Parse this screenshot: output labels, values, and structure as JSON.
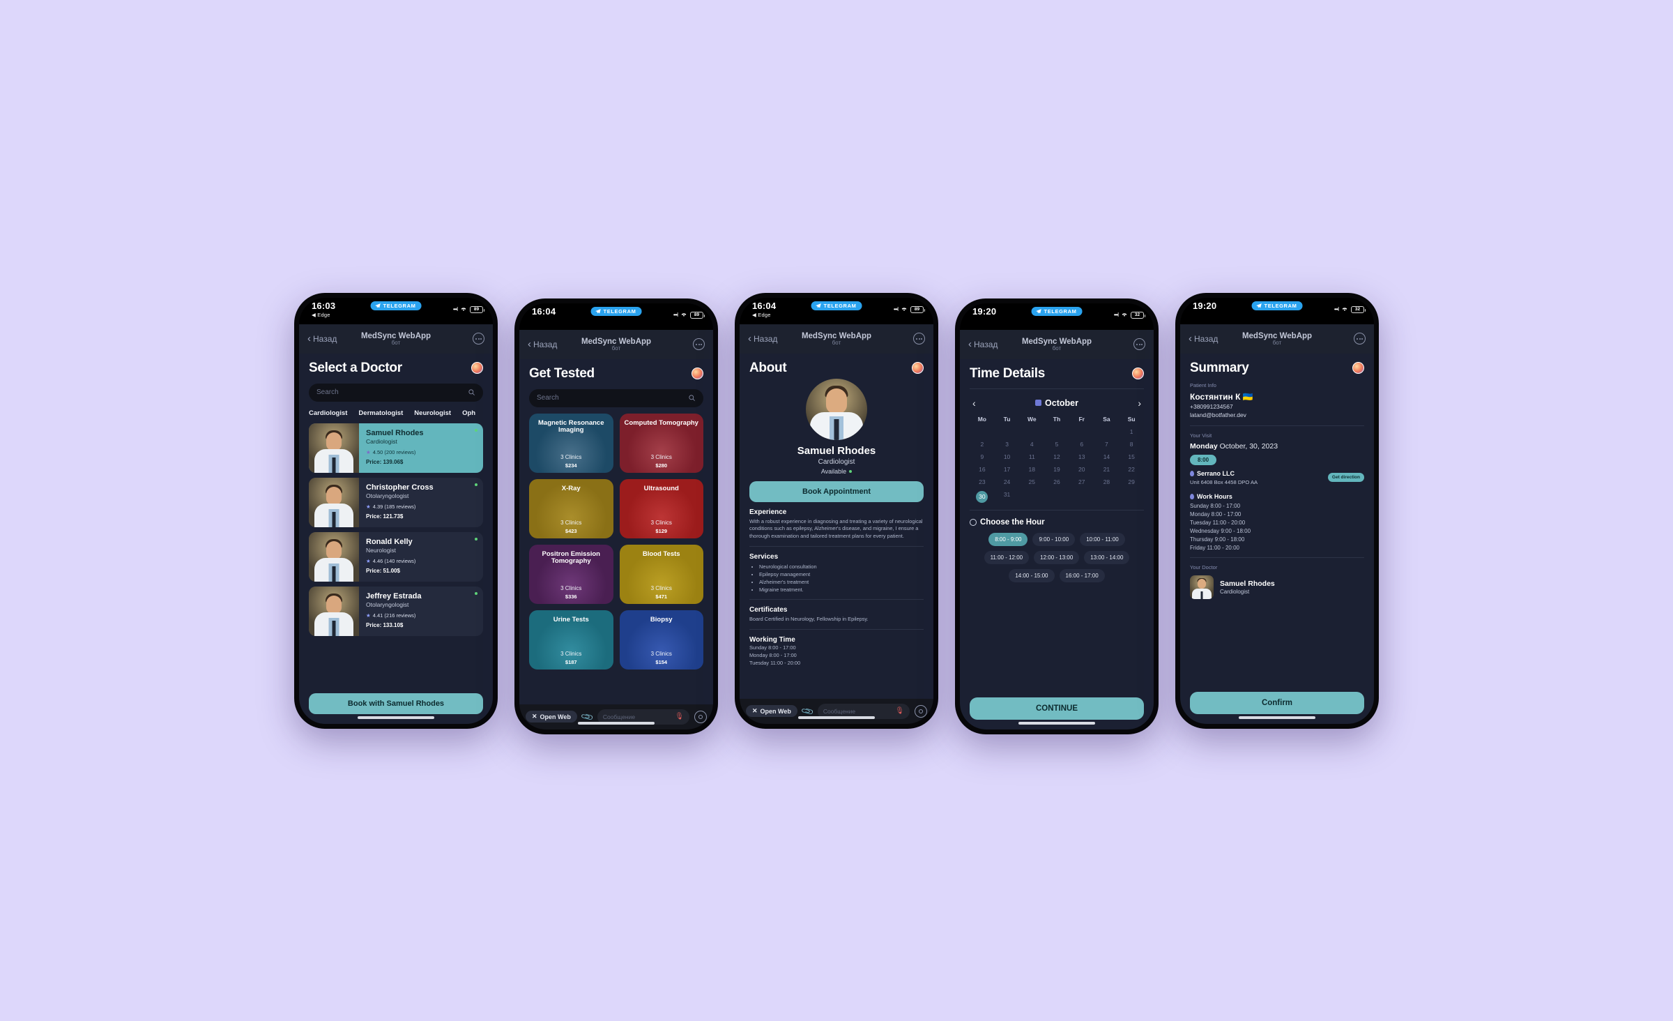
{
  "common": {
    "telegram_pill": "TELEGRAM",
    "back_label": "Назад",
    "nav_title": "MedSync WebApp",
    "nav_subtitle": "бот",
    "search_placeholder": "Search",
    "open_web": "Open Web",
    "message_placeholder": "Сообщение",
    "edge_label": "Edge",
    "accent": "#63b6bd",
    "bg": "#1b2032"
  },
  "phone1": {
    "status": {
      "time": "16:03",
      "battery": "89"
    },
    "title": "Select a Doctor",
    "chips": [
      "Cardiologist",
      "Dermatologist",
      "Neurologist",
      "Oph"
    ],
    "doctors": [
      {
        "name": "Samuel Rhodes",
        "spec": "Cardiologist",
        "rating": "4.50 (200 reviews)",
        "price": "Price: 139.06$",
        "selected": true
      },
      {
        "name": "Christopher Cross",
        "spec": "Otolaryngologist",
        "rating": "4.39 (185 reviews)",
        "price": "Price: 121.73$",
        "selected": false
      },
      {
        "name": "Ronald Kelly",
        "spec": "Neurologist",
        "rating": "4.46 (140 reviews)",
        "price": "Price: 51.00$",
        "selected": false
      },
      {
        "name": "Jeffrey Estrada",
        "spec": "Otolaryngologist",
        "rating": "4.41 (216 reviews)",
        "price": "Price: 133.10$",
        "selected": false
      }
    ],
    "cta": "Book with Samuel Rhodes"
  },
  "phone2": {
    "status": {
      "time": "16:04",
      "battery": "89"
    },
    "title": "Get Tested",
    "tests": [
      {
        "name": "Magnetic Resonance Imaging",
        "clinics": "3 Clinics",
        "price": "$234",
        "color": "#1d4a66"
      },
      {
        "name": "Computed Tomography",
        "clinics": "3 Clinics",
        "price": "$280",
        "color": "#7d1f2b"
      },
      {
        "name": "X-Ray",
        "clinics": "3 Clinics",
        "price": "$423",
        "color": "#8a7016"
      },
      {
        "name": "Ultrasound",
        "clinics": "3 Clinics",
        "price": "$129",
        "color": "#9c1c1c"
      },
      {
        "name": "Positron Emission Tomography",
        "clinics": "3 Clinics",
        "price": "$336",
        "color": "#4a1f52"
      },
      {
        "name": "Blood Tests",
        "clinics": "3 Clinics",
        "price": "$471",
        "color": "#9c8212"
      },
      {
        "name": "Urine Tests",
        "clinics": "3 Clinics",
        "price": "$187",
        "color": "#1c6c7d"
      },
      {
        "name": "Biopsy",
        "clinics": "3 Clinics",
        "price": "$154",
        "color": "#1f3f8c"
      }
    ]
  },
  "phone3": {
    "status": {
      "time": "16:04",
      "battery": "89"
    },
    "title": "About",
    "doctor": {
      "name": "Samuel Rhodes",
      "spec": "Cardiologist",
      "available": "Available"
    },
    "book_button": "Book Appointment",
    "experience_heading": "Experience",
    "experience_text": "With a robust experience in diagnosing and treating a variety of neurological conditions such as epilepsy, Alzheimer's disease, and migraine, I ensure a thorough examination and tailored treatment plans for every patient.",
    "services_heading": "Services",
    "services": [
      "Neurological consultation",
      "Epilepsy management",
      "Alzheimer's treatment",
      "Migraine treatment."
    ],
    "certificates_heading": "Certificates",
    "certificates_text": "Board Certified in Neurology, Fellowship in Epilepsy.",
    "working_heading": "Working Time",
    "working": [
      "Sunday 8:00 - 17:00",
      "Monday 8:00 - 17:00",
      "Tuesday 11:00 - 20:00"
    ]
  },
  "phone4": {
    "status": {
      "time": "19:20",
      "battery": "32"
    },
    "title": "Time Details",
    "month": "October",
    "dow": [
      "Mo",
      "Tu",
      "We",
      "Th",
      "Fr",
      "Sa",
      "Su"
    ],
    "leading_blanks": 6,
    "days": [
      1,
      2,
      3,
      4,
      5,
      6,
      7,
      8,
      9,
      10,
      11,
      12,
      13,
      14,
      15,
      16,
      17,
      18,
      19,
      20,
      21,
      22,
      23,
      24,
      25,
      26,
      27,
      28,
      29,
      30,
      31
    ],
    "selected_day": 30,
    "hour_heading": "Choose the Hour",
    "hours": [
      "8:00 - 9:00",
      "9:00 - 10:00",
      "10:00 - 11:00",
      "11:00 - 12:00",
      "12:00 - 13:00",
      "13:00 - 14:00",
      "14:00 - 15:00",
      "16:00 - 17:00"
    ],
    "selected_hour": "8:00 - 9:00",
    "cta": "CONTINUE"
  },
  "phone5": {
    "status": {
      "time": "19:20",
      "battery": "32"
    },
    "title": "Summary",
    "patient_label": "Patient Info",
    "patient_name": "Костянтин К 🇺🇦",
    "patient_phone": "+380991234567",
    "patient_email": "latand@botfather.dev",
    "visit_label": "Your Visit",
    "visit_day": "Monday",
    "visit_date": "October, 30, 2023",
    "visit_time": "8:00",
    "clinic": "Serrano LLC",
    "clinic_address": "Unit 6408 Box 4458 DPO AA",
    "get_direction": "Get direction",
    "work_hours_heading": "Work Hours",
    "work_hours": [
      "Sunday 8:00 - 17:00",
      "Monday 8:00 - 17:00",
      "Tuesday 11:00 - 20:00",
      "Wednesday 9:00 - 18:00",
      "Thursday 9:00 - 18:00",
      "Friday 11:00 - 20:00"
    ],
    "doctor_label": "Your Doctor",
    "doctor_name": "Samuel Rhodes",
    "doctor_spec": "Cardiologist",
    "cta": "Confirm"
  }
}
